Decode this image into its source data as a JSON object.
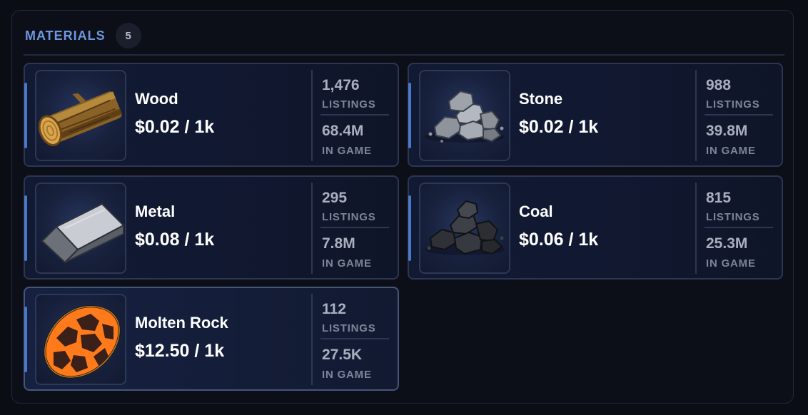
{
  "header": {
    "title": "MATERIALS",
    "count": "5"
  },
  "materials": [
    {
      "name": "Wood",
      "price": "$0.02 / 1k",
      "listings": "1,476",
      "listings_label": "LISTINGS",
      "in_game": "68.4M",
      "in_game_label": "IN GAME",
      "icon": "wood-log-icon"
    },
    {
      "name": "Stone",
      "price": "$0.02 / 1k",
      "listings": "988",
      "listings_label": "LISTINGS",
      "in_game": "39.8M",
      "in_game_label": "IN GAME",
      "icon": "stone-pile-icon"
    },
    {
      "name": "Metal",
      "price": "$0.08 / 1k",
      "listings": "295",
      "listings_label": "LISTINGS",
      "in_game": "7.8M",
      "in_game_label": "IN GAME",
      "icon": "metal-ingot-icon"
    },
    {
      "name": "Coal",
      "price": "$0.06 / 1k",
      "listings": "815",
      "listings_label": "LISTINGS",
      "in_game": "25.3M",
      "in_game_label": "IN GAME",
      "icon": "coal-pile-icon"
    },
    {
      "name": "Molten Rock",
      "price": "$12.50 / 1k",
      "listings": "112",
      "listings_label": "LISTINGS",
      "in_game": "27.5K",
      "in_game_label": "IN GAME",
      "icon": "molten-rock-icon"
    }
  ],
  "colors": {
    "accent": "#6f96df",
    "selected_border": "#45567a",
    "card_border": "#2c3650"
  }
}
